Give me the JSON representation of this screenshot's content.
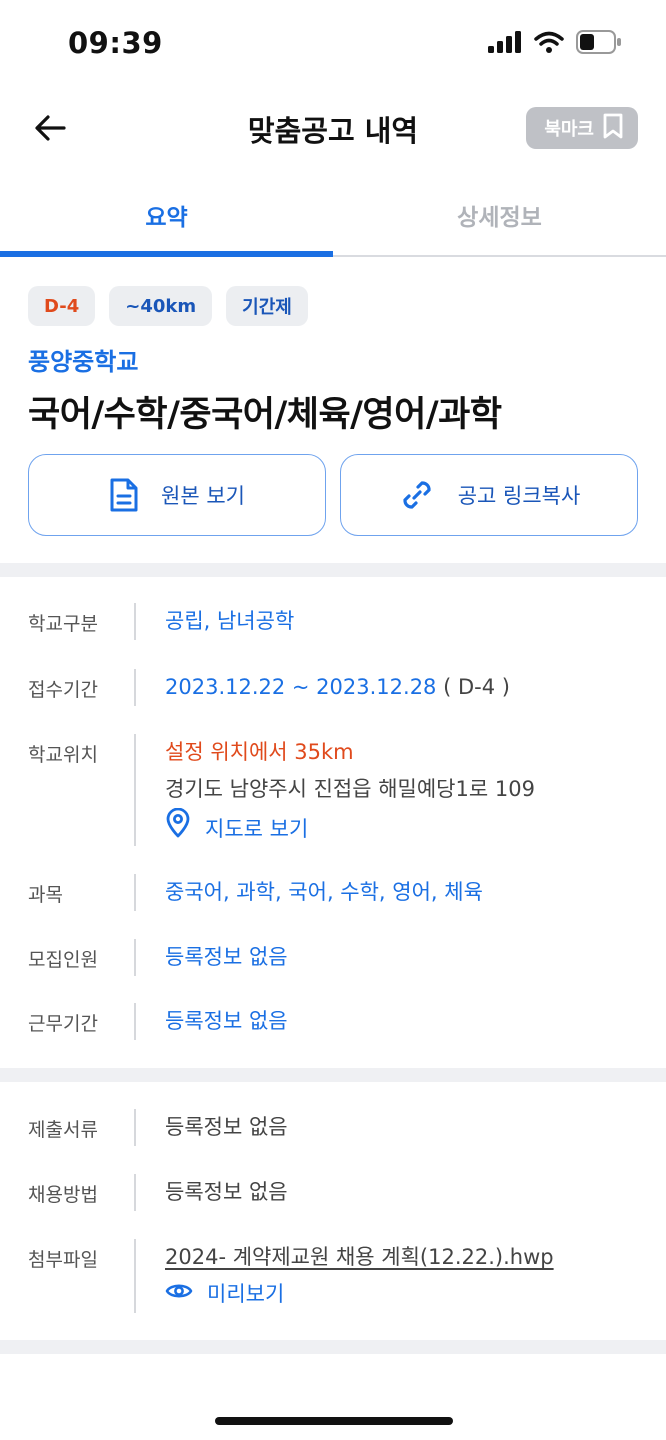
{
  "status": {
    "time": "09:39"
  },
  "nav": {
    "title": "맞춤공고 내역",
    "bookmark_label": "북마크"
  },
  "tabs": [
    {
      "label": "요약"
    },
    {
      "label": "상세정보"
    }
  ],
  "summary": {
    "chips": [
      {
        "label": "D-4"
      },
      {
        "label": "~40km"
      },
      {
        "label": "기간제"
      }
    ],
    "school_name": "풍양중학교",
    "subjects_title": "국어/수학/중국어/체육/영어/과학",
    "buttons": {
      "view_original": "원본 보기",
      "copy_link": "공고 링크복사"
    }
  },
  "info": {
    "school_type": {
      "label": "학교구분",
      "value": "공립, 남녀공학"
    },
    "period": {
      "label": "접수기간",
      "value": "2023.12.22 ~ 2023.12.28",
      "dday": "( D-4 )"
    },
    "location": {
      "label": "학교위치",
      "distance": "설정 위치에서 35km",
      "address": "경기도 남양주시 진접읍 해밀예당1로 109",
      "map_link": "지도로 보기"
    },
    "subjects": {
      "label": "과목",
      "value": "중국어, 과학, 국어, 수학, 영어, 체육"
    },
    "recruit": {
      "label": "모집인원",
      "value": "등록정보 없음"
    },
    "work_period": {
      "label": "근무기간",
      "value": "등록정보 없음"
    }
  },
  "docs": {
    "documents": {
      "label": "제출서류",
      "value": "등록정보 없음"
    },
    "method": {
      "label": "채용방법",
      "value": "등록정보 없음"
    },
    "attachment": {
      "label": "첨부파일",
      "file_name": "2024- 계약제교원 채용 계획(12.22.).hwp",
      "preview": "미리보기"
    }
  },
  "colors": {
    "accent": "#1a6fe3",
    "warning": "#e04a1c",
    "muted": "#b0b3b9"
  }
}
